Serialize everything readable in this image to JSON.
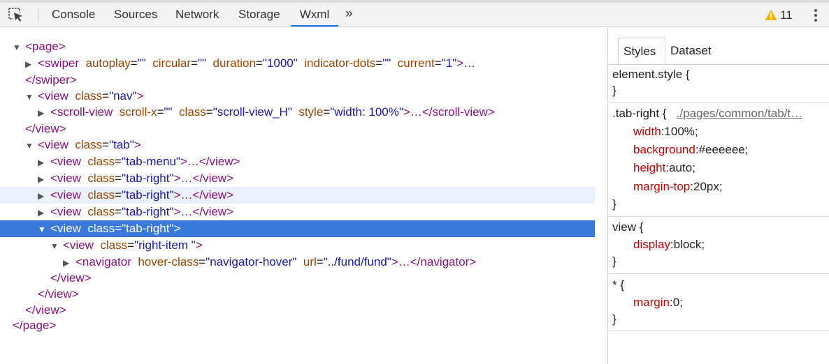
{
  "toolbar": {
    "tabs": [
      "Console",
      "Sources",
      "Network",
      "Storage",
      "Wxml"
    ],
    "active_tab": "Wxml",
    "more_label": "»",
    "warning_count": "11"
  },
  "tree": {
    "r1": {
      "tag_open": "<page>"
    },
    "r2": {
      "open": "<swiper",
      "a1": "autoplay",
      "v1": "\"\"",
      "a2": "circular",
      "v2": "\"\"",
      "a3": "duration",
      "v3": "\"1000\"",
      "a4": "indicator-dots",
      "v4": "\"\"",
      "a5": "current",
      "v5": "\"1\"",
      "tail": ">…"
    },
    "r3": {
      "close": "</swiper>"
    },
    "r4": {
      "open": "<view",
      "a1": "class",
      "v1": "\"nav\"",
      "tail": ">"
    },
    "r5": {
      "open": "<scroll-view",
      "a1": "scroll-x",
      "v1": "\"\"",
      "a2": "class",
      "v2": "\"scroll-view_H\"",
      "a3": "style",
      "v3": "\"width: 100%\"",
      "tail": ">…</scroll-view>"
    },
    "r6": {
      "close": "</view>"
    },
    "r7": {
      "open": "<view",
      "a1": "class",
      "v1": "\"tab\"",
      "tail": ">"
    },
    "r8": {
      "open": "<view",
      "a1": "class",
      "v1": "\"tab-menu\"",
      "tail": ">…</view>"
    },
    "r9": {
      "open": "<view",
      "a1": "class",
      "v1": "\"tab-right\"",
      "tail": ">…</view>"
    },
    "r10": {
      "open": "<view",
      "a1": "class",
      "v1": "\"tab-right\"",
      "tail": ">…</view>"
    },
    "r11": {
      "open": "<view",
      "a1": "class",
      "v1": "\"tab-right\"",
      "tail": ">…</view>"
    },
    "r12": {
      "open": "<view",
      "a1": "class",
      "v1": "\"tab-right\"",
      "tail": ">"
    },
    "r13": {
      "open": "<view",
      "a1": "class",
      "v1": "\"right-item \"",
      "tail": ">"
    },
    "r14": {
      "open": "<navigator",
      "a1": "hover-class",
      "v1": "\"navigator-hover\"",
      "a2": "url",
      "v2": "\"../fund/fund\"",
      "tail": ">…</navigator>"
    },
    "r15": {
      "close": "</view>"
    },
    "r16": {
      "close": "</view>"
    },
    "r17": {
      "close": "</view>"
    },
    "r18": {
      "close": "</page>"
    }
  },
  "sidebar": {
    "tabs": [
      "Styles",
      "Dataset"
    ],
    "active_tab": "Styles",
    "rule1": {
      "selector": "element.style {",
      "close": "}"
    },
    "rule2": {
      "selector": ".tab-right {",
      "source": "./pages/common/tab/t…",
      "props": [
        {
          "name": "width",
          "value": "100%;"
        },
        {
          "name": "background",
          "value": "#eeeeee;"
        },
        {
          "name": "height",
          "value": "auto;"
        },
        {
          "name": "margin-top",
          "value": "20px;"
        }
      ],
      "close": "}"
    },
    "rule3": {
      "selector": "view {",
      "props": [
        {
          "name": "display",
          "value": "block;"
        }
      ],
      "close": "}"
    },
    "rule4": {
      "selector": "* {",
      "props": [
        {
          "name": "margin",
          "value": "0;"
        }
      ],
      "close": "}"
    }
  },
  "colors": {
    "selection": "#3879d9",
    "hover_row": "#ebf1fb",
    "tag": "#881280",
    "attribute": "#994500",
    "value": "#1a1aa6",
    "css_property": "#c80000",
    "active_tab_underline": "#1a73e8",
    "warning": "#f4b400"
  }
}
